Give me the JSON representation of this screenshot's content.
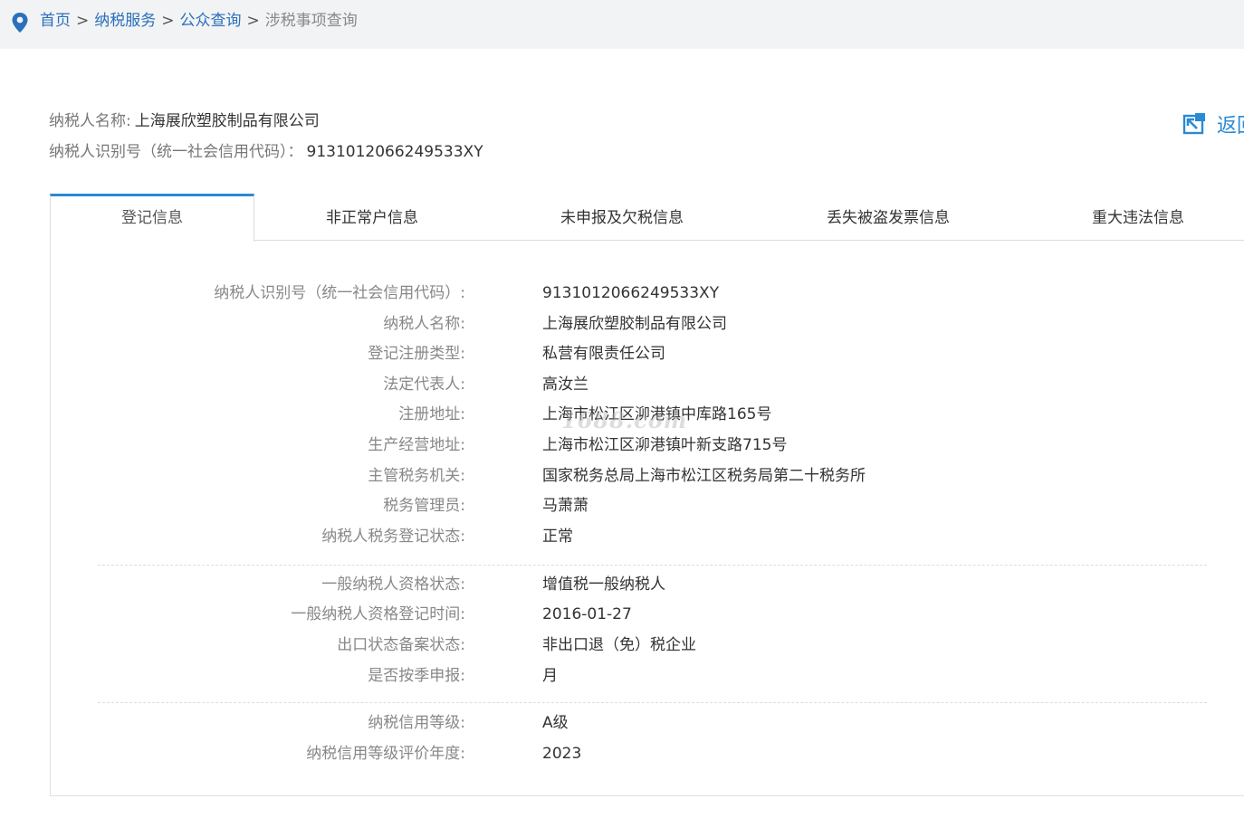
{
  "breadcrumb": {
    "items": [
      "首页",
      "纳税服务",
      "公众查询"
    ],
    "separator": ">",
    "current": "涉税事项查询"
  },
  "taxpayer": {
    "name_label": "纳税人名称:",
    "name_value": "上海展欣塑胶制品有限公司",
    "id_label": "纳税人识别号（统一社会信用代码）：",
    "id_value": "9131012066249533XY"
  },
  "back_button": {
    "label": "返回"
  },
  "tabs": [
    {
      "label": "登记信息",
      "active": true
    },
    {
      "label": "非正常户信息",
      "active": false
    },
    {
      "label": "未申报及欠税信息",
      "active": false
    },
    {
      "label": "丢失被盗发票信息",
      "active": false
    },
    {
      "label": "重大违法信息",
      "active": false
    }
  ],
  "registration": {
    "group1": [
      {
        "label": "纳税人识别号（统一社会信用代码）:",
        "value": "9131012066249533XY"
      },
      {
        "label": "纳税人名称:",
        "value": "上海展欣塑胶制品有限公司"
      },
      {
        "label": "登记注册类型:",
        "value": "私营有限责任公司"
      },
      {
        "label": "法定代表人:",
        "value": "高汝兰"
      },
      {
        "label": "注册地址:",
        "value": "上海市松江区泖港镇中库路165号"
      },
      {
        "label": "生产经营地址:",
        "value": "上海市松江区泖港镇叶新支路715号"
      },
      {
        "label": "主管税务机关:",
        "value": "国家税务总局上海市松江区税务局第二十税务所"
      },
      {
        "label": "税务管理员:",
        "value": "马萧萧"
      },
      {
        "label": "纳税人税务登记状态:",
        "value": "正常"
      }
    ],
    "group2": [
      {
        "label": "一般纳税人资格状态:",
        "value": "增值税一般纳税人"
      },
      {
        "label": "一般纳税人资格登记时间:",
        "value": "2016-01-27"
      },
      {
        "label": "出口状态备案状态:",
        "value": "非出口退（免）税企业"
      },
      {
        "label": "是否按季申报:",
        "value": "月"
      }
    ],
    "group3": [
      {
        "label": "纳税信用等级:",
        "value": "A级"
      },
      {
        "label": "纳税信用等级评价年度:",
        "value": "2023"
      }
    ]
  },
  "watermark": "1688.com",
  "colors": {
    "link": "#2a6fbb",
    "accent": "#2a8ad4"
  },
  "icons": {
    "breadcrumb": "location-pin-icon",
    "back": "back-arrow-icon"
  }
}
